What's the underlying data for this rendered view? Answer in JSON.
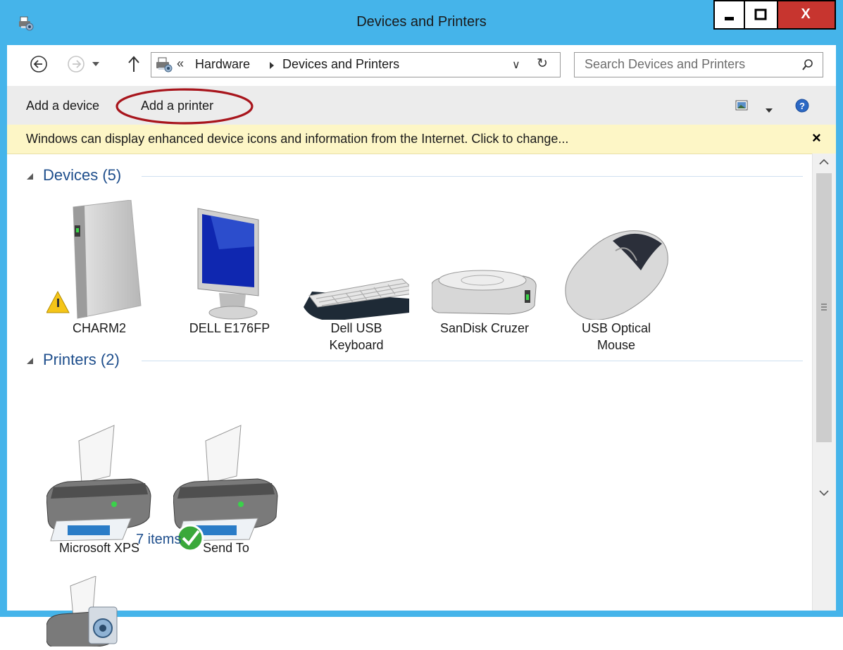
{
  "window": {
    "title": "Devices and Printers",
    "buttons": [
      "minimize-icon",
      "maximize-icon",
      "close-icon"
    ],
    "close_label": "X"
  },
  "address": {
    "overflow": "«",
    "crumbs": [
      "Hardware",
      "Devices and Printers"
    ],
    "dropdown": "∨",
    "refresh": "↻"
  },
  "search": {
    "placeholder": "Search Devices and Printers"
  },
  "commands": {
    "add_device": "Add a device",
    "add_printer": "Add a printer"
  },
  "infobar": {
    "text": "Windows can display enhanced device icons and information from the Internet. Click to change...",
    "close": "×"
  },
  "groups": {
    "devices": {
      "title": "Devices (5)"
    },
    "printers": {
      "title": "Printers (2)"
    }
  },
  "devices": [
    {
      "name": "CHARM2",
      "icon": "computer-tower-icon"
    },
    {
      "name": "DELL E176FP",
      "icon": "monitor-icon"
    },
    {
      "name": "Dell USB\nKeyboard",
      "icon": "keyboard-icon"
    },
    {
      "name": "SanDisk Cruzer",
      "icon": "drive-icon"
    },
    {
      "name": "USB Optical\nMouse",
      "icon": "mouse-icon"
    }
  ],
  "printers": [
    {
      "name": "Microsoft XPS",
      "icon": "printer-icon"
    },
    {
      "name": "Send To",
      "icon": "printer-icon"
    }
  ],
  "details": {
    "count": "7 items"
  },
  "colors": {
    "frame": "#45b4ea",
    "link": "#1e4e8c",
    "highlight_circle": "#a8151c",
    "infobar_bg": "#fdf6c6",
    "close_button": "#c7352f"
  }
}
